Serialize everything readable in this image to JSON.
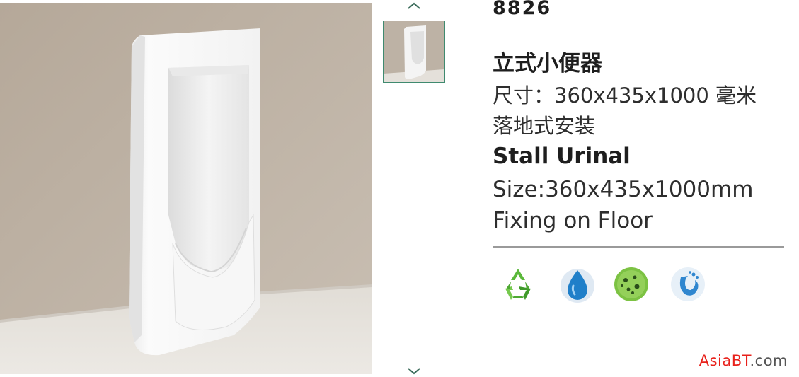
{
  "gallery": {
    "main_image": "stall-urinal-photo",
    "thumbnails": [
      "stall-urinal-thumbnail"
    ],
    "prev_icon": "chevron-up-icon",
    "next_icon": "chevron-down-icon"
  },
  "product": {
    "model": "8826",
    "cn_title": "立式小便器",
    "cn_size": "尺寸：360x435x1000 毫米",
    "cn_install": "落地式安装",
    "en_title": "Stall Urinal",
    "en_size": "Size:360x435x1000mm",
    "en_install": "Fixing on Floor"
  },
  "features": [
    "recycle-icon",
    "water-drop-icon",
    "antibacterial-icon",
    "water-saving-icon"
  ],
  "watermark": {
    "brand_a": "Asia",
    "brand_b": "BT",
    "suffix": ".com"
  },
  "colors": {
    "accent": "#3f8a6f",
    "watermark": "#e8211b",
    "text": "#2b2b2b"
  }
}
